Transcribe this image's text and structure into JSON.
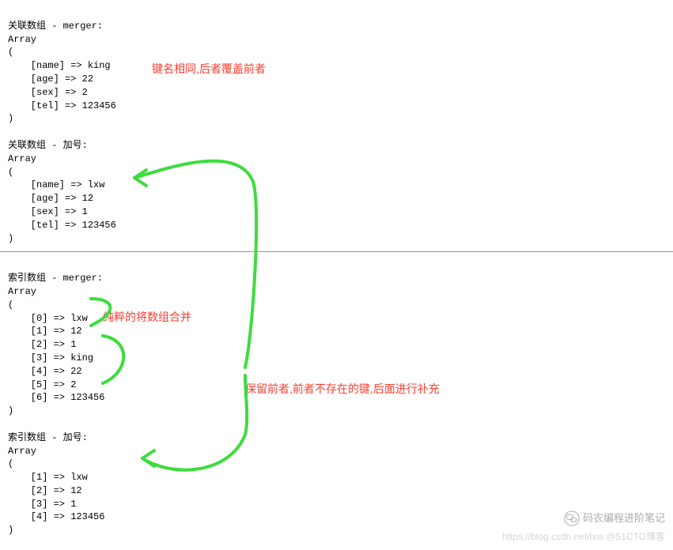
{
  "block1": {
    "header": "关联数组 - merger:",
    "arr": "Array",
    "open": "(",
    "l1": "    [name] => king",
    "l2": "    [age] => 22",
    "l3": "    [sex] => 2",
    "l4": "    [tel] => 123456",
    "close": ")"
  },
  "annotation1": "键名相同,后者覆盖前者",
  "block2": {
    "header": "关联数组 - 加号:",
    "arr": "Array",
    "open": "(",
    "l1": "    [name] => lxw",
    "l2": "    [age] => 12",
    "l3": "    [sex] => 1",
    "l4": "    [tel] => 123456",
    "close": ")"
  },
  "block3": {
    "header": "索引数组 - merger:",
    "arr": "Array",
    "open": "(",
    "l1": "    [0] => lxw",
    "l2": "    [1] => 12",
    "l3": "    [2] => 1",
    "l4": "    [3] => king",
    "l5": "    [4] => 22",
    "l6": "    [5] => 2",
    "l7": "    [6] => 123456",
    "close": ")"
  },
  "annotation2": "纯粹的将数组合并",
  "annotation3": "保留前者,前者不存在的键,后面进行补充",
  "block4": {
    "header": "索引数组 - 加号:",
    "arr": "Array",
    "open": "(",
    "l1": "    [1] => lxw",
    "l2": "    [2] => 12",
    "l3": "    [3] => 1",
    "l4": "    [4] => 123456",
    "close": ")"
  },
  "wechat_label": "码农编程进阶笔记",
  "watermark_text": "https://blog.csdn.net/lxw @51CTO博客"
}
